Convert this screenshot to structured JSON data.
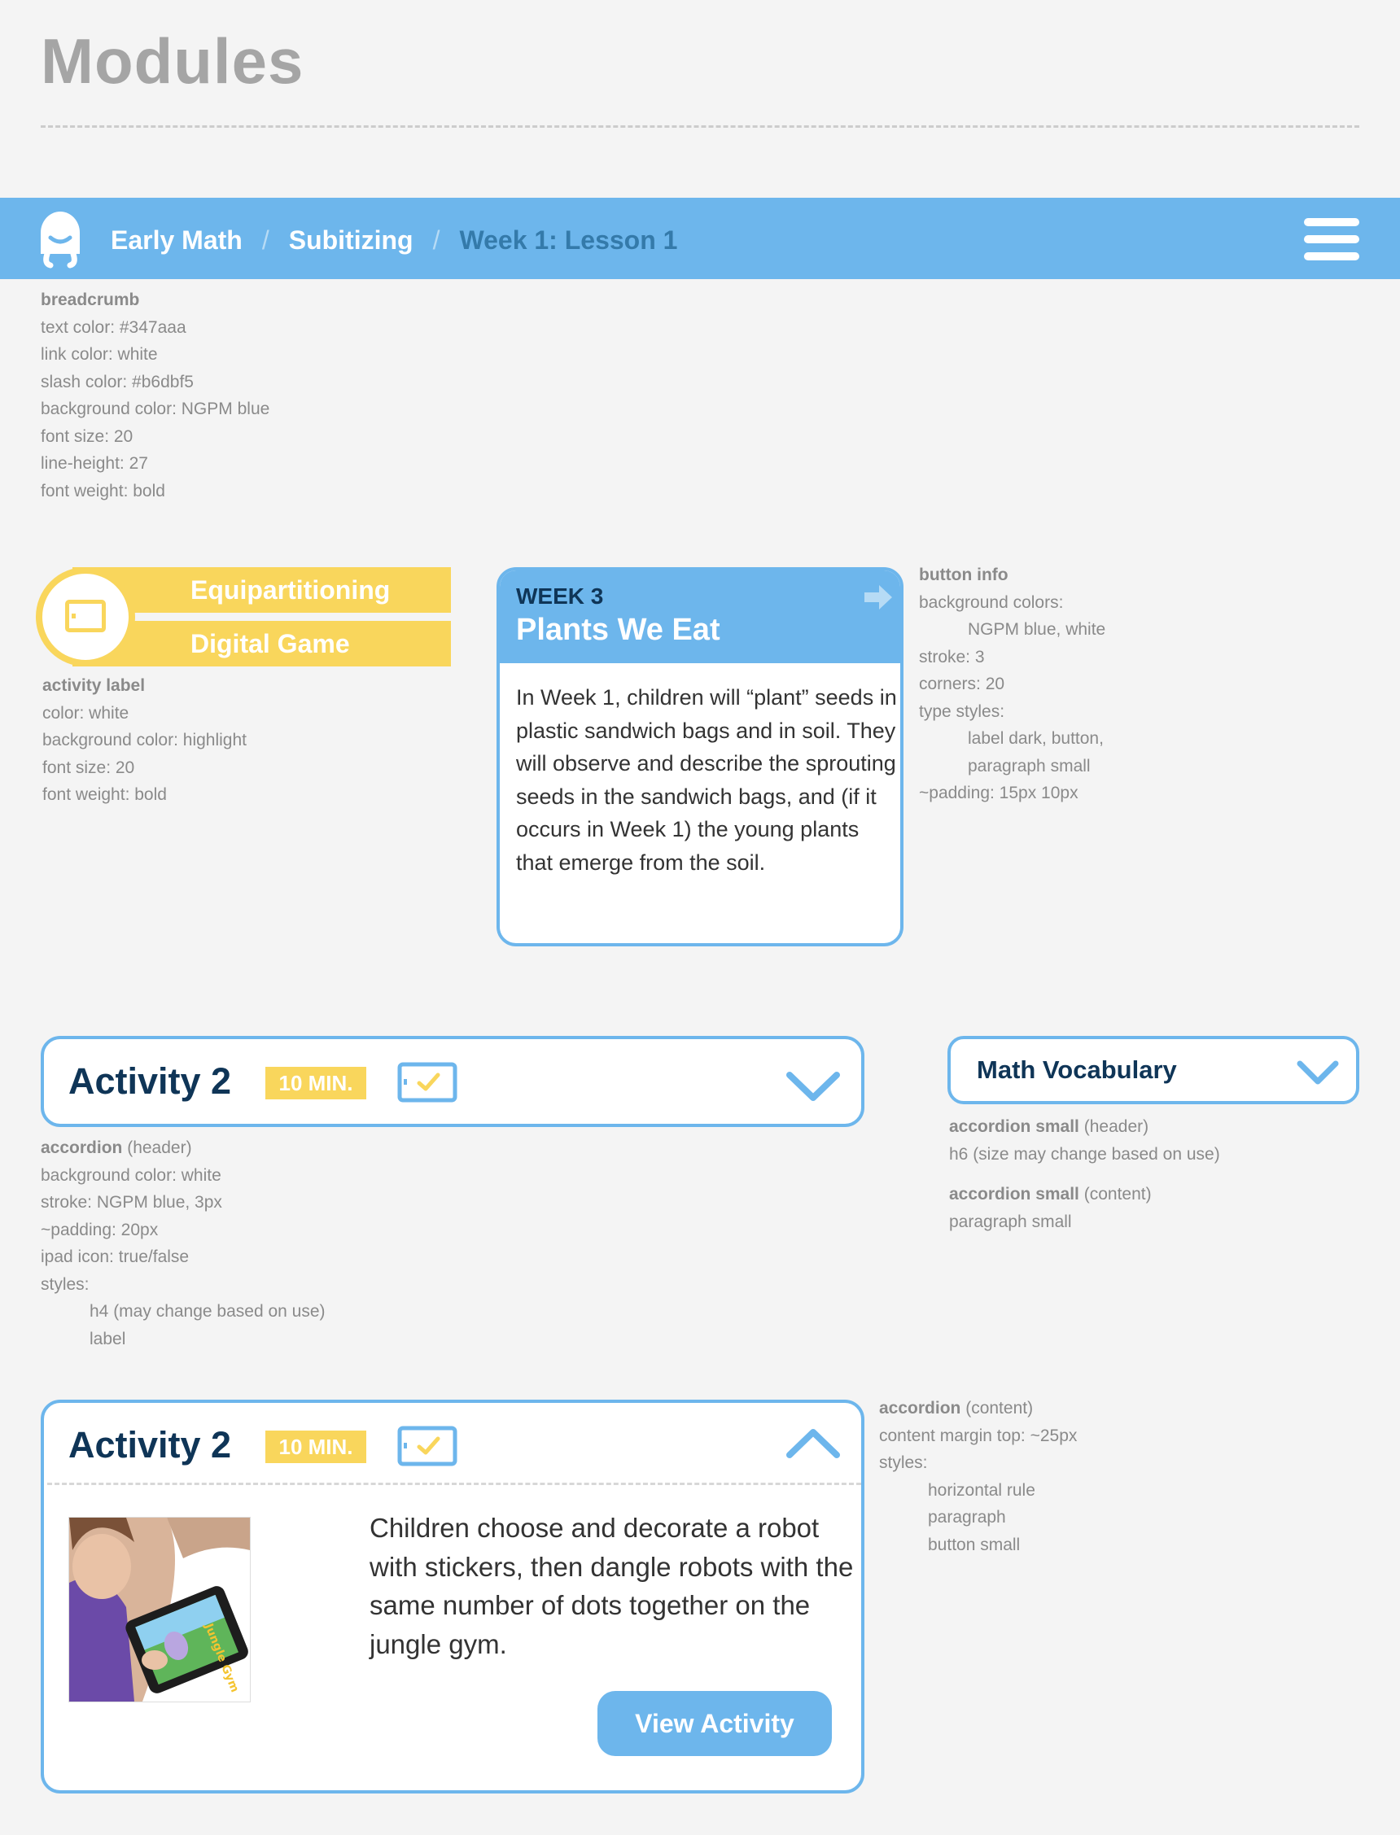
{
  "page": {
    "title": "Modules"
  },
  "breadcrumb": {
    "items": [
      "Early Math",
      "Subitizing"
    ],
    "current": "Week 1: Lesson 1",
    "separator": "/",
    "colors": {
      "text": "#347aaa",
      "link": "#ffffff",
      "slash": "#b6dbf5",
      "background": "#6db6ec"
    }
  },
  "notes": {
    "breadcrumb": {
      "heading": "breadcrumb",
      "lines": [
        "text color: #347aaa",
        "link color: white",
        "slash color: #b6dbf5",
        "background color: NGPM blue",
        "font size: 20",
        "line-height: 27",
        "font weight: bold"
      ]
    },
    "activity_label": {
      "heading": "activity label",
      "lines": [
        "color: white",
        "background color: highlight",
        "font size: 20",
        "font weight: bold"
      ]
    },
    "button_info": {
      "heading": "button info",
      "lines": [
        "background colors:",
        "NGPM blue, white",
        "stroke: 3",
        "corners: 20",
        "type styles:",
        "label dark, button,",
        "paragraph small",
        "~padding: 15px 10px"
      ]
    },
    "accordion_header": {
      "heading": "accordion",
      "suffix": "(header)",
      "lines": [
        "background color: white",
        "stroke: NGPM blue, 3px",
        "~padding: 20px",
        "ipad icon: true/false",
        "styles:",
        "h4 (may change based on use)",
        "label"
      ]
    },
    "accordion_small_header": {
      "heading": "accordion small",
      "suffix": "(header)",
      "line": "h6 (size may change based on use)"
    },
    "accordion_small_content": {
      "heading": "accordion small",
      "suffix": "(content)",
      "line": "paragraph small"
    },
    "accordion_content": {
      "heading": "accordion",
      "suffix": "(content)",
      "lines": [
        "content margin top: ~25px",
        "styles:",
        "horizontal rule",
        "paragraph",
        "button small"
      ]
    }
  },
  "activity_label": {
    "line1": "Equipartitioning",
    "line2": "Digital Game",
    "color": "#f9d65c",
    "icon": "tablet-icon"
  },
  "week_card": {
    "week": "WEEK 3",
    "title": "Plants We Eat",
    "text": "In Week 1, children will “plant” seeds in plastic sandwich bags and in soil. They will observe and describe the sprouting seeds in the sandwich bags, and (if it occurs in Week 1) the young plants that emerge from the soil.",
    "icon": "arrow-right-icon"
  },
  "accordion_collapsed": {
    "title": "Activity 2",
    "badge": "10 MIN.",
    "icon": "ipad-check-icon",
    "chevron": "chevron-down-icon"
  },
  "accordion_small": {
    "title": "Math Vocabulary",
    "chevron": "chevron-down-icon"
  },
  "accordion_expanded": {
    "title": "Activity 2",
    "badge": "10 MIN.",
    "icon": "ipad-check-icon",
    "chevron": "chevron-up-icon",
    "text": "Children choose and decorate a robot with stickers, then dangle robots with the same number of dots together on the jungle gym.",
    "button": "View Activity",
    "photo_caption": "Jungle Gym"
  },
  "colors": {
    "ngpm_blue": "#6db6ec",
    "highlight": "#f9d65c",
    "dark": "#0f3557",
    "note": "#8a8a8a"
  }
}
